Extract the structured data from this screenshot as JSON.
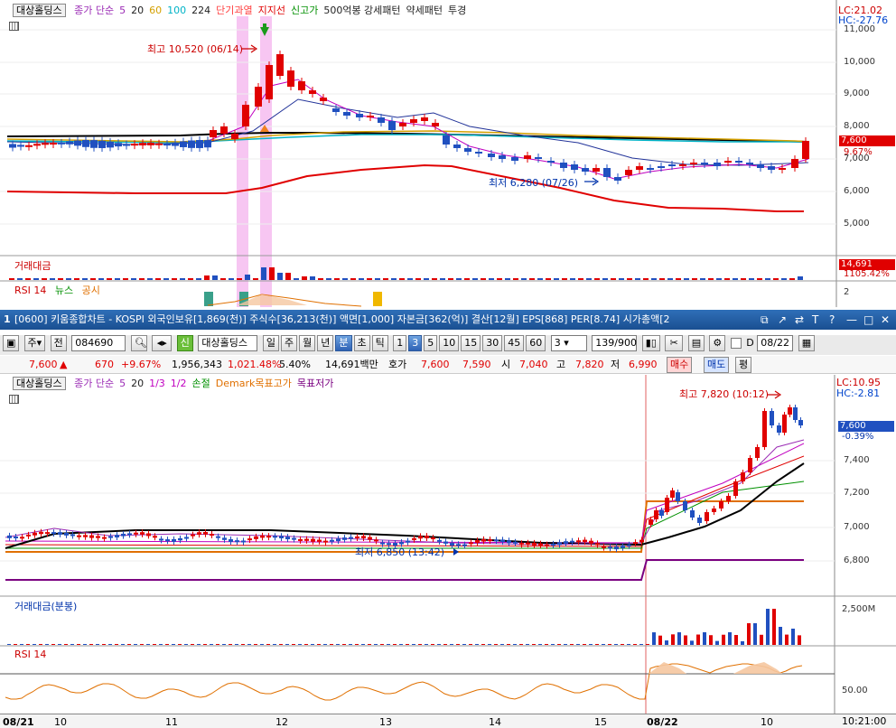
{
  "top_chart": {
    "stock_name": "대상홀딩스",
    "legend": [
      {
        "text": "종가 단순",
        "color": "#9b2cb5"
      },
      {
        "text": "5",
        "color": "#9b2cb5"
      },
      {
        "text": "20",
        "color": "#222222"
      },
      {
        "text": "60",
        "color": "#d4a000"
      },
      {
        "text": "100",
        "color": "#00b3c7"
      },
      {
        "text": "224",
        "color": "#222222"
      },
      {
        "text": "단기과열",
        "color": "#ff4040"
      },
      {
        "text": "지지선",
        "color": "#e00000"
      },
      {
        "text": "신고가",
        "color": "#009000"
      },
      {
        "text": "500억봉 강세패턴",
        "color": "#222222"
      },
      {
        "text": "약세패턴",
        "color": "#222222"
      },
      {
        "text": "투경",
        "color": "#222222"
      }
    ],
    "lc": "LC:21.02",
    "hc": "HC:-27.76",
    "price_axis": [
      "11,000",
      "10,000",
      "9,000",
      "8,000",
      "7,000",
      "6,000",
      "5,000"
    ],
    "current_price": "7,600",
    "current_pct": "9.67%",
    "high_label": "최고 10,520 (06/14)",
    "low_label": "최저 6,280 (07/26)",
    "volume_label": "거래대금",
    "volume_value": "14,691",
    "volume_pct": "1105.42%",
    "rsi_label": "RSI 14",
    "news_label": "뉴스",
    "disclosure_label": "공시",
    "rsi_value": "2"
  },
  "window": {
    "number": "1",
    "title": "[0600] 키움종합차트 - KOSPI 외국인보유[1,869(천)] 주식수[36,213(천)] 액면[1,000] 자본금[362(억)] 결산[12월] EPS[868] PER[8.74] 시가총액[2",
    "ctrl_icons": [
      "restore-icon",
      "pin-icon",
      "link-icon",
      "text-icon",
      "help-icon",
      "minimize-icon",
      "maximize-icon",
      "close-icon"
    ],
    "ctrl_glyphs": [
      "⧉",
      "↗",
      "⇄",
      "T",
      "?",
      "—",
      "□",
      "✕"
    ]
  },
  "toolbar": {
    "market": "주",
    "period_prefix": "전",
    "code": "084690",
    "badge": "신",
    "name": "대상홀딩스",
    "periods": [
      "일",
      "주",
      "월",
      "년",
      "분",
      "초",
      "틱"
    ],
    "selected_period": "분",
    "minutes": [
      "1",
      "3",
      "5",
      "10",
      "15",
      "30",
      "45",
      "60"
    ],
    "selected_minute": "3",
    "count_value": "3",
    "range": "139/900",
    "d_label": "D",
    "date": "08/22"
  },
  "quote": {
    "price": "7,600",
    "arrow": "▲",
    "change": "670",
    "change_pct": "+9.67%",
    "volume": "1,956,343",
    "volume_pct": "1,021.48%",
    "turnover": "5.40%",
    "amount": "14,691백만",
    "ask_label": "호가",
    "ask": "7,600",
    "bid": "7,590",
    "open_label": "시",
    "open": "7,040",
    "high_label": "고",
    "high": "7,820",
    "low_label": "저",
    "low": "6,990",
    "buy": "매수",
    "sell": "매도",
    "eval": "평"
  },
  "bottom_chart": {
    "stock_name": "대상홀딩스",
    "legend": [
      {
        "text": "종가 단순",
        "color": "#9b2cb5"
      },
      {
        "text": "5",
        "color": "#9b2cb5"
      },
      {
        "text": "20",
        "color": "#222222"
      },
      {
        "text": "1/3",
        "color": "#c000c0"
      },
      {
        "text": "1/2",
        "color": "#c000c0"
      },
      {
        "text": "손절",
        "color": "#009000"
      },
      {
        "text": "Demark목표고가",
        "color": "#e07000"
      },
      {
        "text": "목표저가",
        "color": "#7a0080"
      }
    ],
    "lc": "LC:10.95",
    "hc": "HC:-2.81",
    "price_axis": [
      "7,400",
      "7,200",
      "7,000",
      "6,800"
    ],
    "current_price": "7,600",
    "current_pct": "-0.39%",
    "high_label": "최고 7,820 (10:12)",
    "low_label": "최저 6,850 (13:42)",
    "volume_label": "거래대금(분봉)",
    "volume_axis": "2,500M",
    "rsi_label": "RSI 14",
    "rsi_axis": "50.00"
  },
  "date_axis": {
    "labels": [
      "08/21",
      "10",
      "11",
      "12",
      "13",
      "14",
      "15",
      "08/22",
      "10"
    ],
    "time": "10:21:00"
  }
}
